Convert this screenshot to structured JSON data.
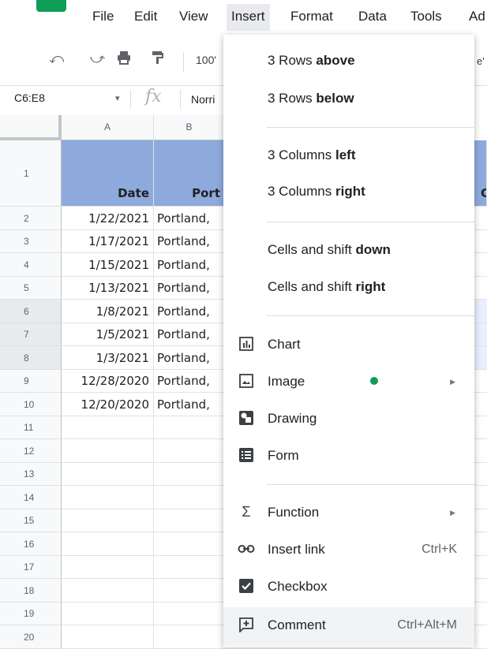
{
  "menubar": {
    "items": [
      "File",
      "Edit",
      "View",
      "Insert",
      "Format",
      "Data",
      "Tools",
      "Ad"
    ]
  },
  "toolbar": {
    "zoom": "100'",
    "right_hint": "e'"
  },
  "formula_bar": {
    "name_box": "C6:E8",
    "fx": "fx",
    "value": "Norri"
  },
  "sheet": {
    "column_headers": [
      "A",
      "B"
    ],
    "row_numbers": [
      "1",
      "2",
      "3",
      "4",
      "5",
      "6",
      "7",
      "8",
      "9",
      "10",
      "11",
      "12",
      "13",
      "14",
      "15",
      "16",
      "17",
      "18",
      "19",
      "20"
    ],
    "header_row": {
      "a": "Date",
      "b": "Port",
      "c": "C"
    },
    "rows": [
      {
        "a": "1/22/2021",
        "b": "Portland,"
      },
      {
        "a": "1/17/2021",
        "b": "Portland,"
      },
      {
        "a": "1/15/2021",
        "b": "Portland,"
      },
      {
        "a": "1/13/2021",
        "b": "Portland,"
      },
      {
        "a": "1/8/2021",
        "b": "Portland,"
      },
      {
        "a": "1/5/2021",
        "b": "Portland,"
      },
      {
        "a": "1/3/2021",
        "b": "Portland,"
      },
      {
        "a": "12/28/2020",
        "b": "Portland,"
      },
      {
        "a": "12/20/2020",
        "b": "Portland,"
      }
    ]
  },
  "insert_menu": {
    "rows_above": {
      "pre": "3 Rows ",
      "bold": "above"
    },
    "rows_below": {
      "pre": "3 Rows ",
      "bold": "below"
    },
    "cols_left": {
      "pre": "3 Columns ",
      "bold": "left"
    },
    "cols_right": {
      "pre": "3 Columns ",
      "bold": "right"
    },
    "cells_down": {
      "pre": "Cells and shift ",
      "bold": "down"
    },
    "cells_right": {
      "pre": "Cells and shift ",
      "bold": "right"
    },
    "chart": "Chart",
    "image": "Image",
    "drawing": "Drawing",
    "form": "Form",
    "function": "Function",
    "insert_link": "Insert link",
    "insert_link_shortcut": "Ctrl+K",
    "checkbox": "Checkbox",
    "comment": "Comment",
    "comment_shortcut": "Ctrl+Alt+M"
  },
  "colors": {
    "header_fill": "#8eaadc",
    "brand_green": "#0f9d58"
  }
}
